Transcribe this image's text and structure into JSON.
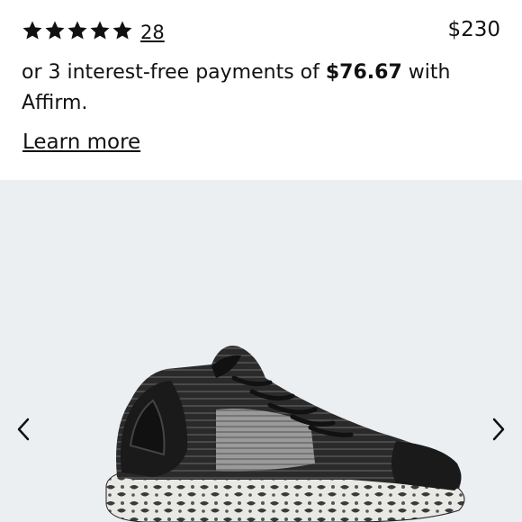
{
  "product": {
    "rating_stars": 5,
    "review_count": "28",
    "price": "$230"
  },
  "financing": {
    "prefix": "or 3 interest-free payments of ",
    "amount": "$76.67",
    "suffix": " with Affirm.",
    "learn_more_label": "Learn more"
  },
  "gallery": {
    "prev_icon": "chevron-left-icon",
    "next_icon": "chevron-right-icon",
    "background_color": "#eceff1"
  },
  "colors": {
    "text": "#111111",
    "shoe_primary": "#1a1a1a",
    "shoe_secondary": "#8a8a8a"
  }
}
